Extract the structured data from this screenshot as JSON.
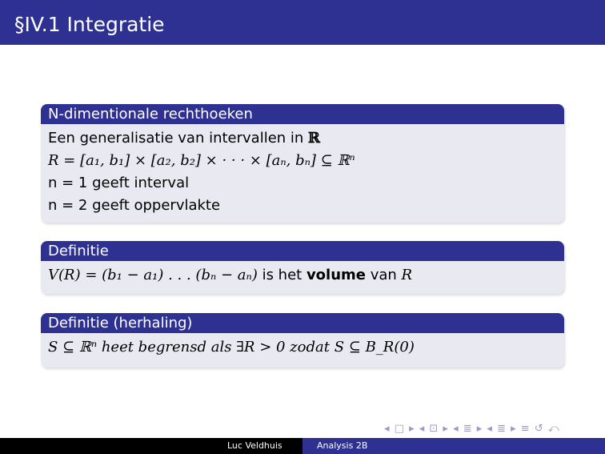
{
  "slide": {
    "title": "§IV.1 Integratie"
  },
  "blocks": [
    {
      "header": "N-dimentionale rechthoeken",
      "line1_text": "Een generalisatie van intervallen in ",
      "line1_set": "ℝ",
      "line2": "R = [a₁, b₁] × [a₂, b₂] × · · · × [aₙ, bₙ] ⊆ ℝⁿ",
      "line3": "n = 1 geeft interval",
      "line4": "n = 2 geeft oppervlakte"
    },
    {
      "header": "Definitie",
      "formula": "V(R) = (b₁ − a₁) . . . (bₙ − aₙ)",
      "text_mid": " is het ",
      "bold": "volume",
      "text_end": " van ",
      "var": "R"
    },
    {
      "header": "Definitie (herhaling)",
      "line": "S ⊆ ℝⁿ heet begrensd als ∃R > 0 zodat S ⊆ B_R(0)"
    }
  ],
  "nav": {
    "symbols": "◂ □ ▸ ◂ ⊡ ▸ ◂ ≣ ▸ ◂ ≣ ▸ ≡ ↺ ⤺"
  },
  "footer": {
    "author": "Luc Veldhuis",
    "course": "Analysis 2B"
  },
  "colors": {
    "primary": "#2e3192",
    "block_body": "#e9e9f2"
  }
}
